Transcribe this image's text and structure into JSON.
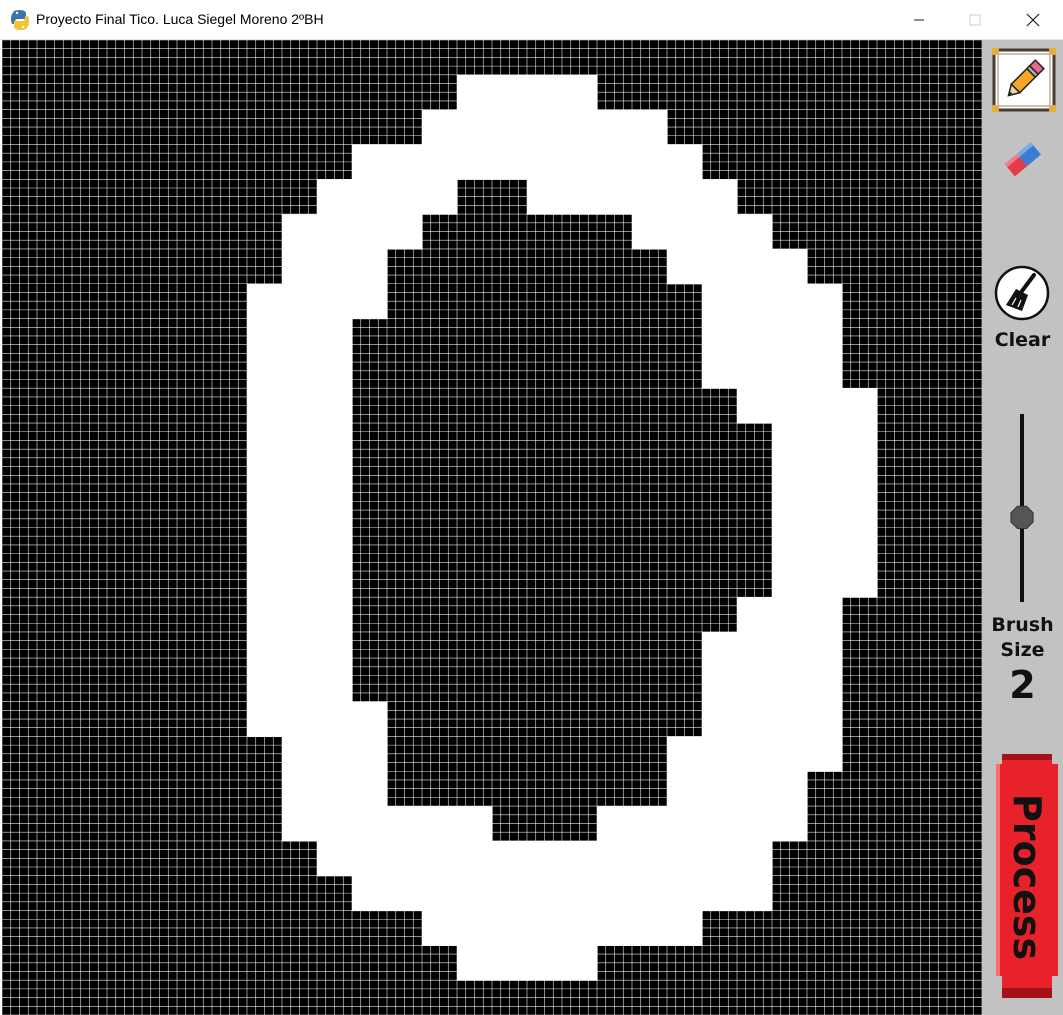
{
  "window": {
    "title": "Proyecto Final Tico. Luca Siegel Moreno 2ºBH",
    "icon": "python-icon",
    "controls": [
      "minimize",
      "maximize",
      "close"
    ]
  },
  "canvas": {
    "cols": 28,
    "rows": 28,
    "background_color": "#000000",
    "paint_color": "#ffffff",
    "grid_color": "#ffffff",
    "pixels": [
      "0000000000000000000000000000",
      "0000000000000111100000000000",
      "0000000000001111111000000000",
      "0000000000111111111100000000",
      "0000000001111001111110000000",
      "0000000011110000001111000000",
      "0000000011100000000111100000",
      "0000000111100000000011110000",
      "0000000111000000000011110000",
      "0000000111000000000011110000",
      "0000000111000000000001111000",
      "0000000111000000000000111000",
      "0000000111000000000000111000",
      "0000000111000000000000111000",
      "0000000111000000000000111000",
      "0000000111000000000000111000",
      "0000000111000000000001110000",
      "0000000111000000000011110000",
      "0000000111000000000011110000",
      "0000000111100000000011110000",
      "0000000011100000000111110000",
      "0000000011100000000111100000",
      "0000000011111100011111100000",
      "0000000001111111111111000000",
      "0000000000111111111111000000",
      "0000000000001111111100000000",
      "0000000000000111100000000000",
      "0000000000000000000000000000"
    ]
  },
  "sidebar": {
    "background_color": "#c2c2c2",
    "tools": [
      {
        "name": "pencil",
        "icon": "pencil-icon",
        "selected": true
      },
      {
        "name": "eraser",
        "icon": "eraser-icon",
        "selected": false
      }
    ],
    "clear": {
      "icon": "broom-icon",
      "label": "Clear"
    },
    "brush": {
      "label": "Brush\nSize",
      "value": "2",
      "level": 0.55
    },
    "process": {
      "label": "Process",
      "color": "#e8222a"
    }
  }
}
